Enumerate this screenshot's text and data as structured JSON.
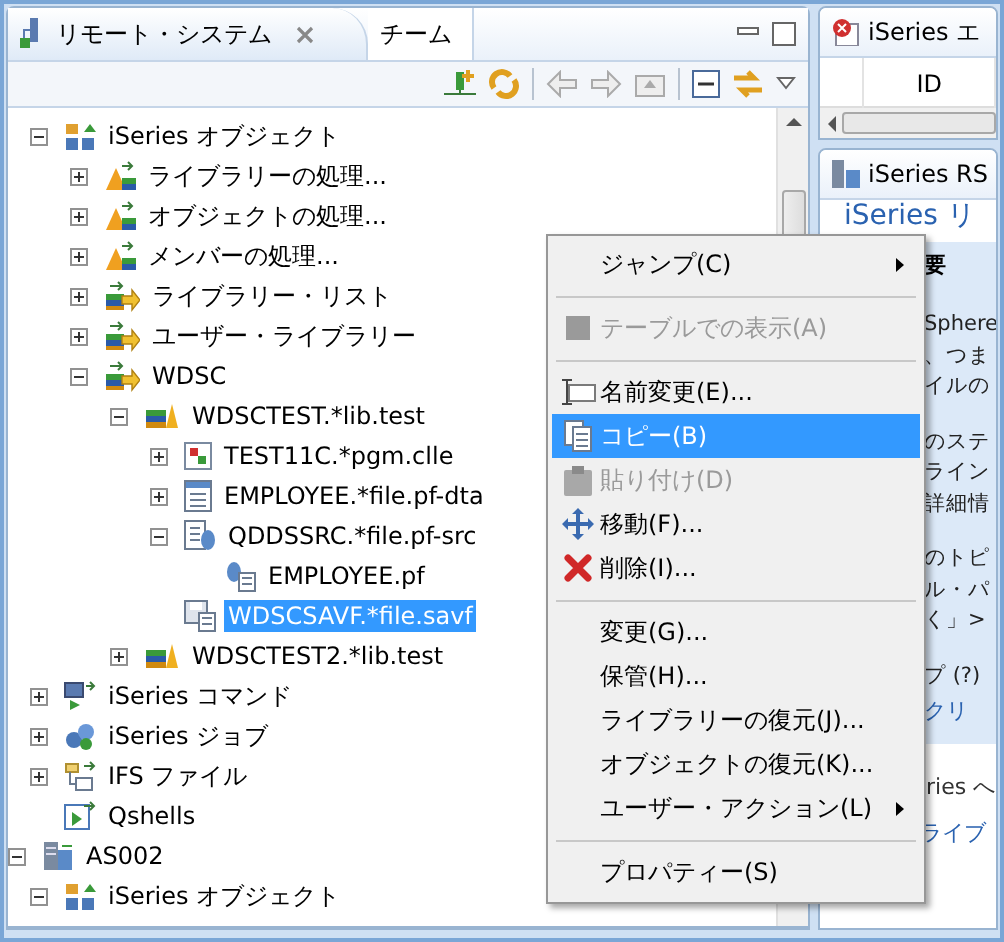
{
  "left_view": {
    "tabs": [
      {
        "label": "リモート・システム",
        "selected": true
      },
      {
        "label": "チーム",
        "selected": false
      }
    ]
  },
  "tree": {
    "items": [
      {
        "children": [
          {
            "label": "iSeries オブジェクト",
            "kind": "objects",
            "expanded": true,
            "selected": false,
            "children": [
              {
                "label": "ライブラリーの処理...",
                "kind": "filter",
                "expanded": false,
                "selected": false
              },
              {
                "label": "オブジェクトの処理...",
                "kind": "filter",
                "expanded": false,
                "selected": false
              },
              {
                "label": "メンバーの処理...",
                "kind": "filter",
                "expanded": false,
                "selected": false
              },
              {
                "label": "ライブラリー・リスト",
                "kind": "liblist",
                "expanded": false,
                "selected": false
              },
              {
                "label": "ユーザー・ライブラリー",
                "kind": "liblist",
                "expanded": false,
                "selected": false
              },
              {
                "label": "WDSC",
                "kind": "liblist",
                "expanded": true,
                "selected": false,
                "children": [
                  {
                    "label": "WDSCTEST.*lib.test",
                    "kind": "library",
                    "expanded": true,
                    "selected": false,
                    "children": [
                      {
                        "label": "TEST11C.*pgm.clle",
                        "kind": "program",
                        "expanded": false,
                        "selected": false
                      },
                      {
                        "label": "EMPLOYEE.*file.pf-dta",
                        "kind": "datafile",
                        "expanded": false,
                        "selected": false
                      },
                      {
                        "label": "QDDSSRC.*file.pf-src",
                        "kind": "sourcefile",
                        "expanded": true,
                        "selected": false,
                        "children": [
                          {
                            "label": "EMPLOYEE.pf",
                            "kind": "member",
                            "selected": false
                          }
                        ]
                      },
                      {
                        "label": "WDSCSAVF.*file.savf",
                        "kind": "savefile",
                        "selected": true
                      }
                    ]
                  },
                  {
                    "label": "WDSCTEST2.*lib.test",
                    "kind": "library",
                    "expanded": false,
                    "selected": false
                  }
                ]
              }
            ]
          },
          {
            "label": "iSeries コマンド",
            "kind": "commands",
            "expanded": false,
            "selected": false
          },
          {
            "label": "iSeries ジョブ",
            "kind": "jobs",
            "expanded": false,
            "selected": false
          },
          {
            "label": "IFS ファイル",
            "kind": "ifs",
            "expanded": false,
            "selected": false
          },
          {
            "label": "Qshells",
            "kind": "shell",
            "selected": false
          }
        ]
      },
      {
        "label": "AS002",
        "kind": "host",
        "expanded": true,
        "selected": false,
        "children": [
          {
            "label": "iSeries オブジェクト",
            "kind": "objects",
            "expanded": true,
            "selected": false
          }
        ]
      }
    ]
  },
  "context_menu": {
    "items": [
      {
        "kind": "item",
        "label": "ジャンプ(C)",
        "submenu": true,
        "disabled": false,
        "selected": false
      },
      {
        "kind": "separator"
      },
      {
        "kind": "table",
        "label": "テーブルでの表示(A)",
        "submenu": false,
        "disabled": true,
        "selected": false
      },
      {
        "kind": "separator"
      },
      {
        "kind": "rename",
        "label": "名前変更(E)...",
        "submenu": false,
        "disabled": false,
        "selected": false
      },
      {
        "kind": "copy",
        "label": "コピー(B)",
        "submenu": false,
        "disabled": false,
        "selected": true
      },
      {
        "kind": "paste",
        "label": "貼り付け(D)",
        "submenu": false,
        "disabled": true,
        "selected": false
      },
      {
        "kind": "move",
        "label": "移動(F)...",
        "submenu": false,
        "disabled": false,
        "selected": false
      },
      {
        "kind": "delete",
        "label": "削除(I)...",
        "submenu": false,
        "disabled": false,
        "selected": false
      },
      {
        "kind": "separator"
      },
      {
        "kind": "item",
        "label": "変更(G)...",
        "submenu": false,
        "disabled": false,
        "selected": false
      },
      {
        "kind": "item",
        "label": "保管(H)...",
        "submenu": false,
        "disabled": false,
        "selected": false
      },
      {
        "kind": "item",
        "label": "ライブラリーの復元(J)...",
        "submenu": false,
        "disabled": false,
        "selected": false
      },
      {
        "kind": "item",
        "label": "オブジェクトの復元(K)...",
        "submenu": false,
        "disabled": false,
        "selected": false
      },
      {
        "kind": "item",
        "label": "ユーザー・アクション(L)",
        "submenu": true,
        "disabled": false,
        "selected": false
      },
      {
        "kind": "separator"
      },
      {
        "kind": "item",
        "label": "プロパティー(S)",
        "submenu": false,
        "disabled": false,
        "selected": false
      }
    ]
  },
  "error_view": {
    "tab": "iSeries エ",
    "columns": [
      "ID"
    ]
  },
  "rse_view": {
    "tab": "iSeries RS",
    "heading": "iSeries リ",
    "summary_title": "要",
    "paragraphs": [
      [
        "Sphere",
        "、つま",
        "イルの"
      ],
      [
        "のステ",
        "ライン",
        "詳細情"
      ],
      [
        "のトピ",
        "ル・パ",
        "く」>"
      ],
      [
        "プ (?)"
      ]
    ],
    "link": "クリ",
    "section_title": "ries へ",
    "list_item": "ライブ"
  }
}
